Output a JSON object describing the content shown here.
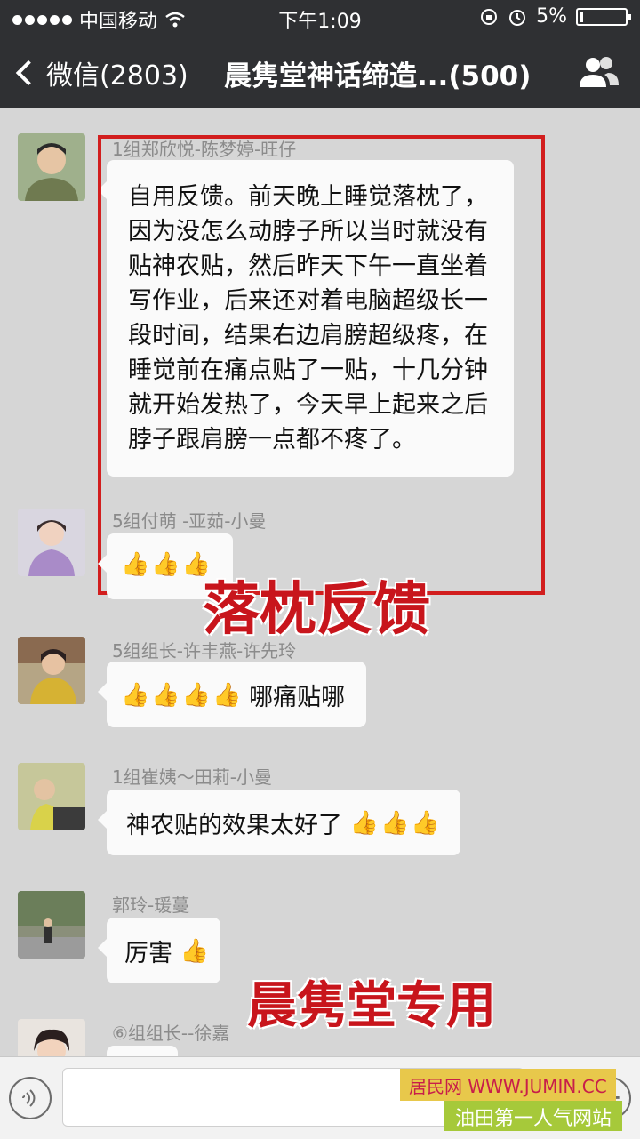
{
  "status_bar": {
    "carrier": "中国移动",
    "time": "下午1:09",
    "battery_percent": "5%"
  },
  "nav": {
    "back_label": "微信(2803)",
    "title": "晨隽堂神话缔造...(500)"
  },
  "messages": [
    {
      "sender": "1组郑欣悦-陈梦婷-旺仔",
      "text": "自用反馈。前天晚上睡觉落枕了，因为没怎么动脖子所以当时就没有贴神农贴，然后昨天下午一直坐着写作业，后来还对着电脑超级长一段时间，结果右边肩膀超级疼，在睡觉前在痛点贴了一贴，十几分钟就开始发热了，今天早上起来之后脖子跟肩膀一点都不疼了。",
      "thumbs": 0,
      "thumbs_after": 0
    },
    {
      "sender": "5组付萌 -亚茹-小曼",
      "text": "",
      "thumbs": 3,
      "thumbs_after": 0
    },
    {
      "sender": "5组组长-许丰燕-许先玲",
      "text": "哪痛贴哪",
      "thumbs": 4,
      "thumbs_after": 0
    },
    {
      "sender": "1组崔姨～田莉-小曼",
      "text": "神农贴的效果太好了",
      "thumbs": 0,
      "thumbs_after": 3
    },
    {
      "sender": "郭玲-瑗蔓",
      "text": "厉害",
      "thumbs": 0,
      "thumbs_after": 1
    },
    {
      "sender": "⑥组组长--徐嘉",
      "text": "",
      "thumbs": 0,
      "thumbs_after": 0
    }
  ],
  "overlay": {
    "caption_top": "落枕反馈",
    "caption_bottom": "晨隽堂专用"
  },
  "watermark": {
    "line1": "居民网 WWW.JUMIN.CC",
    "line2": "油田第一人气网站"
  },
  "colors": {
    "header_bg": "#2f3033",
    "chat_bg": "#d6d6d6",
    "highlight_red": "#d21e1e",
    "overlay_red": "#c8151c"
  }
}
